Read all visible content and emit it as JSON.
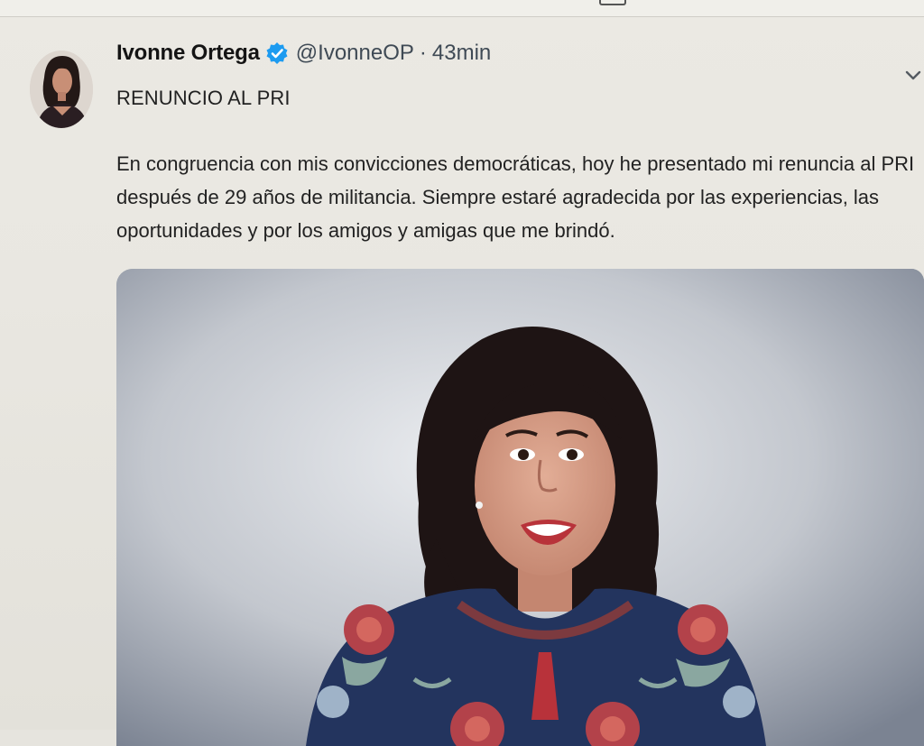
{
  "tweet": {
    "author_name": "Ivonne Ortega",
    "handle": "@IvonneOP",
    "separator": "·",
    "time": "43min",
    "headline": "RENUNCIO AL PRI",
    "body": "En congruencia con mis convicciones democráticas, hoy he presentado mi renuncia al PRI después de 29 años de militancia. Siempre estaré agradecida por las experiencias, las oportunidades y por los amigos y amigas que me brindó."
  },
  "icons": {
    "verified": "verified-badge-icon",
    "more": "chevron-down-icon"
  },
  "colors": {
    "verified_blue": "#1d9bf0",
    "text": "#222222",
    "meta_text": "#3f4a55"
  }
}
